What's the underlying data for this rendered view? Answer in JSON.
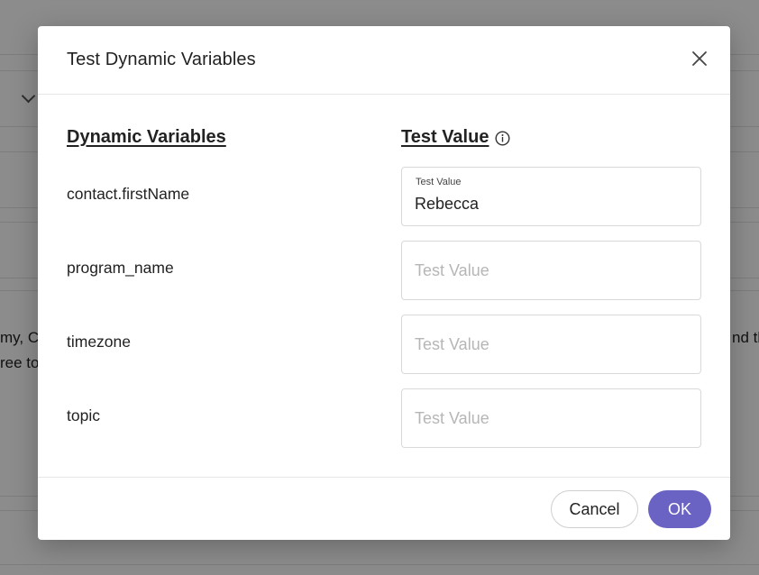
{
  "background": {
    "text_left": "my, C",
    "text_left_2": "ree to",
    "text_right": "nd th"
  },
  "dialog": {
    "title": "Test Dynamic Variables",
    "close_icon": "close-icon",
    "columns": {
      "variables_header": "Dynamic Variables",
      "test_value_header": "Test Value",
      "info_icon": "info-icon"
    },
    "rows": [
      {
        "variable": "contact.firstName",
        "label": "Test Value",
        "value": "Rebecca",
        "placeholder": ""
      },
      {
        "variable": "program_name",
        "label": "",
        "value": "",
        "placeholder": "Test Value"
      },
      {
        "variable": "timezone",
        "label": "",
        "value": "",
        "placeholder": "Test Value"
      },
      {
        "variable": "topic",
        "label": "",
        "value": "",
        "placeholder": "Test Value"
      }
    ],
    "footer": {
      "cancel_label": "Cancel",
      "ok_label": "OK"
    }
  },
  "colors": {
    "primary": "#6a63c4",
    "overlay": "rgba(0,0,0,0.45)",
    "text": "#222222",
    "border": "#d9d9d9"
  }
}
